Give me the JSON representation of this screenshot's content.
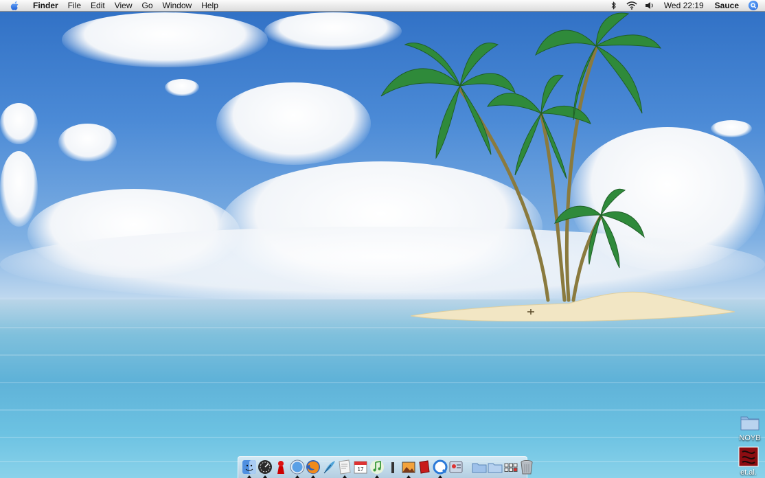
{
  "menubar": {
    "app_name": "Finder",
    "menus": [
      "File",
      "Edit",
      "View",
      "Go",
      "Window",
      "Help"
    ],
    "clock": "Wed 22:19",
    "user": "Sauce"
  },
  "desktop": {
    "icons": [
      {
        "label": "NOYB",
        "icon": "folder-icon"
      },
      {
        "label": "et.al.",
        "icon": "image-file-icon"
      }
    ]
  },
  "dock": {
    "apps": [
      {
        "icon": "finder-icon",
        "running": true
      },
      {
        "icon": "dashboard-icon",
        "running": true
      },
      {
        "icon": "chess-piece-icon",
        "running": false
      },
      {
        "icon": "safari-compass-icon",
        "running": true
      },
      {
        "icon": "firefox-icon",
        "running": true
      },
      {
        "icon": "quill-icon",
        "running": false
      },
      {
        "icon": "text-document-icon",
        "running": true
      },
      {
        "icon": "calendar-icon",
        "running": false
      },
      {
        "icon": "music-note-icon",
        "running": true
      },
      {
        "icon": "terminal-icon",
        "running": false
      },
      {
        "icon": "photo-viewer-icon",
        "running": true
      },
      {
        "icon": "red-book-icon",
        "running": false
      },
      {
        "icon": "quicktime-icon",
        "running": true
      },
      {
        "icon": "tools-icon",
        "running": false
      }
    ],
    "docs": [
      {
        "icon": "folder-stack-icon"
      },
      {
        "icon": "folder-stack-2-icon"
      },
      {
        "icon": "grid-icon"
      },
      {
        "icon": "trash-icon"
      }
    ]
  }
}
